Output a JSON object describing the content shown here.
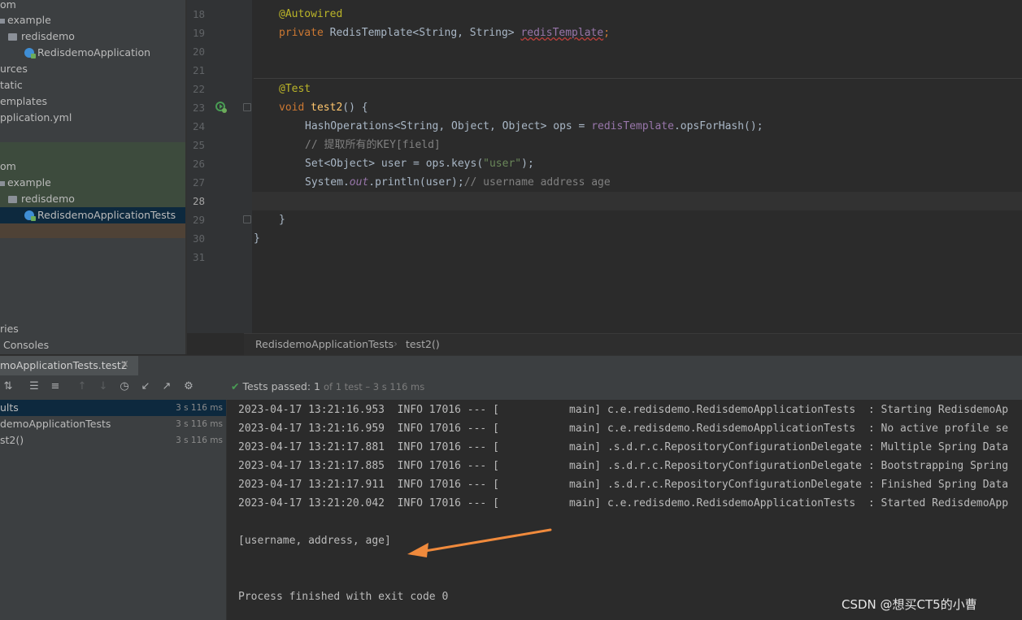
{
  "project_tree": {
    "items": [
      {
        "label": "om",
        "icon": "none",
        "top": 0
      },
      {
        "label": "example",
        "icon": "folder"
      },
      {
        "label": "redisdemo",
        "icon": "folder"
      },
      {
        "label": "RedisdemoApplication",
        "icon": "class"
      },
      {
        "label": "urces",
        "icon": "none"
      },
      {
        "label": "tatic",
        "icon": "none"
      },
      {
        "label": "emplates",
        "icon": "none"
      },
      {
        "label": "pplication.yml",
        "icon": "none"
      },
      {
        "label": "om",
        "icon": "none"
      },
      {
        "label": "example",
        "icon": "folder"
      },
      {
        "label": "redisdemo",
        "icon": "folder"
      },
      {
        "label": "RedisdemoApplicationTests",
        "icon": "class"
      },
      {
        "label": "ries",
        "icon": "none"
      },
      {
        "label": "Consoles",
        "icon": "none"
      }
    ]
  },
  "editor": {
    "line_numbers": [
      "18",
      "19",
      "20",
      "21",
      "22",
      "23",
      "24",
      "25",
      "26",
      "27",
      "28",
      "29",
      "30",
      "31"
    ],
    "code": {
      "l18_ann": "@Autowired",
      "l19_kw": "private",
      "l19_type": " RedisTemplate<String, String> ",
      "l19_field": "redisTemplate",
      "l19_end": ";",
      "l22_ann": "@Test",
      "l23_kw": "void",
      "l23_fn": "test2",
      "l23_rest": "() {",
      "l24_type": "HashOperations<String, Object, Object> ops = ",
      "l24_field": "redisTemplate",
      "l24_rest": ".opsForHash();",
      "l25_cmt": "// 提取所有的KEY[field]",
      "l26_a": "Set<Object> user = ops.keys(",
      "l26_str": "\"user\"",
      "l26_end": ");",
      "l27_a": "System.",
      "l27_out": "out",
      "l27_b": ".println(user);",
      "l27_cmt": "// username address age",
      "l29": "}",
      "l30": "}"
    }
  },
  "breadcrumb": {
    "class": "RedisdemoApplicationTests",
    "sep": "›",
    "method": "test2()"
  },
  "run_panel": {
    "tab_title": "moApplicationTests.test2",
    "tab_close": "×",
    "status_label": "Tests passed:",
    "status_count": "1",
    "status_detail": "of 1 test – 3 s 116 ms",
    "tests": [
      {
        "label": "ults",
        "time": "3 s 116 ms"
      },
      {
        "label": "demoApplicationTests",
        "time": "3 s 116 ms"
      },
      {
        "label": "st2()",
        "time": "3 s 116 ms"
      }
    ],
    "console_lines": [
      "2023-04-17 13:21:16.953  INFO 17016 --- [           main] c.e.redisdemo.RedisdemoApplicationTests  : Starting RedisdemoAp",
      "2023-04-17 13:21:16.959  INFO 17016 --- [           main] c.e.redisdemo.RedisdemoApplicationTests  : No active profile se",
      "2023-04-17 13:21:17.881  INFO 17016 --- [           main] .s.d.r.c.RepositoryConfigurationDelegate : Multiple Spring Data",
      "2023-04-17 13:21:17.885  INFO 17016 --- [           main] .s.d.r.c.RepositoryConfigurationDelegate : Bootstrapping Spring",
      "2023-04-17 13:21:17.911  INFO 17016 --- [           main] .s.d.r.c.RepositoryConfigurationDelegate : Finished Spring Data",
      "2023-04-17 13:21:20.042  INFO 17016 --- [           main] c.e.redisdemo.RedisdemoApplicationTests  : Started RedisdemoApp"
    ],
    "result_line": "[username, address, age]",
    "exit_line": "Process finished with exit code 0"
  },
  "watermark": "CSDN @想买CT5的小曹",
  "colors": {
    "arrow": "#f08a3c",
    "pass_check": "#499c54"
  }
}
